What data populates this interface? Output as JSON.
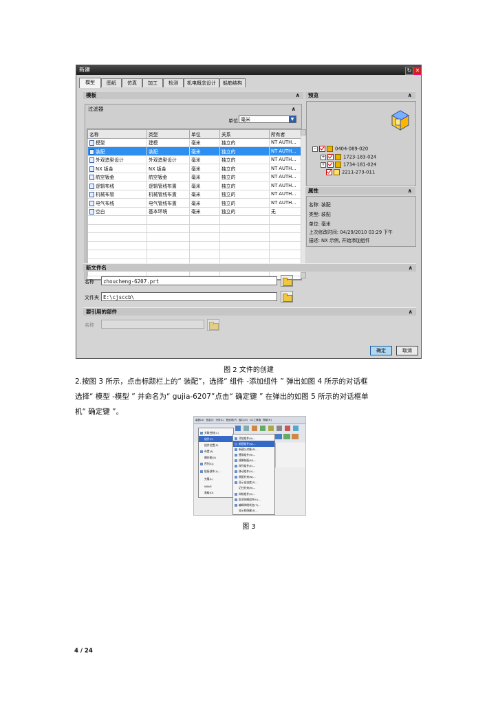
{
  "dialog": {
    "title": "新建",
    "tabs": [
      "模型",
      "图纸",
      "仿真",
      "加工",
      "检测",
      "机电概念设计",
      "船舶结构"
    ],
    "templates_header": "模板",
    "filter_header": "过滤器",
    "unit_label": "单位",
    "unit_value": "毫米",
    "columns": [
      "名称",
      "类型",
      "单位",
      "关系",
      "所有者"
    ],
    "rows": [
      {
        "name": "模型",
        "type": "建模",
        "unit": "毫米",
        "rel": "独立的",
        "owner": "NT AUTH..."
      },
      {
        "name": "装配",
        "type": "装配",
        "unit": "毫米",
        "rel": "独立的",
        "owner": "NT AUTH..."
      },
      {
        "name": "外观造型设计",
        "type": "外观造型设计",
        "unit": "毫米",
        "rel": "独立的",
        "owner": "NT AUTH..."
      },
      {
        "name": "NX 钣金",
        "type": "NX 钣金",
        "unit": "毫米",
        "rel": "独立的",
        "owner": "NT AUTH..."
      },
      {
        "name": "航空钣金",
        "type": "航空钣金",
        "unit": "毫米",
        "rel": "独立的",
        "owner": "NT AUTH..."
      },
      {
        "name": "逻辑布线",
        "type": "逻辑管线布置",
        "unit": "毫米",
        "rel": "独立的",
        "owner": "NT AUTH..."
      },
      {
        "name": "机械布管",
        "type": "机械管线布置",
        "unit": "毫米",
        "rel": "独立的",
        "owner": "NT AUTH..."
      },
      {
        "name": "电气布线",
        "type": "电气管线布置",
        "unit": "毫米",
        "rel": "独立的",
        "owner": "NT AUTH..."
      },
      {
        "name": "空白",
        "type": "基本环境",
        "unit": "毫米",
        "rel": "独立的",
        "owner": "无"
      }
    ],
    "preview_header": "预览",
    "tree": [
      "0404-089-020",
      "1723-183-024",
      "1734-181-024",
      "2211-273-011"
    ],
    "properties_header": "属性",
    "properties": [
      "名称: 装配",
      "类型: 装配",
      "单位: 毫米",
      "上次修改时间: 04/29/2010 03:29 下午",
      "描述: NX 示例, 开始添加组件"
    ],
    "new_file_header": "新文件名",
    "name_label": "名称",
    "name_value": "zhoucheng-6207.prt",
    "folder_label": "文件夹",
    "folder_value": "E:\\cjsccb\\",
    "ref_header": "要引用的部件",
    "ref_name_label": "名称",
    "ok": "确定",
    "cancel": "取消"
  },
  "caption2": "图 2 文件的创建",
  "paragraph": [
    "2.按图  3 所示，点击标题栏上的“      装配”，选择“    组件 -添加组件 ” 弹出如图   4 所示的对话框",
    "选择“   模型 -模型 ” 并命名为“      gujia-6207”点击“    确定键 ” 在弹出的如图    5 所示的对话框单",
    "机“ 确定键 ”。"
  ],
  "fig3": {
    "menubar": [
      "装配(A)",
      "信息(I)",
      "分析(L)",
      "首选项(P)",
      "窗口(O)",
      "GC工具箱",
      "帮助(H)"
    ],
    "menu1": [
      "关联控制(C)",
      "组件(C)",
      "组件位置(P)",
      "布置(A)",
      "爆炸图(X)",
      "序列(Q)",
      "链接部件(L)...",
      "克隆(L)",
      "WAVE",
      "高级(D)"
    ],
    "menu2": [
      "添加组件(A)...",
      "新建组件(N)...",
      "新建父对象(P)...",
      "替换组件(R)...",
      "镜像装配(M)...",
      "阵列组件(E)...",
      "移动组件(V)...",
      "装配约束(N)...",
      "显示自由度(F)...",
      "记住约束(R)...",
      "抑制组件(S)...",
      "取消抑制组件(U)...",
      "编辑抑制状态(T)...",
      "显示和隐藏(E)..."
    ]
  },
  "caption3": "图 3",
  "page_number": "4 / 24"
}
